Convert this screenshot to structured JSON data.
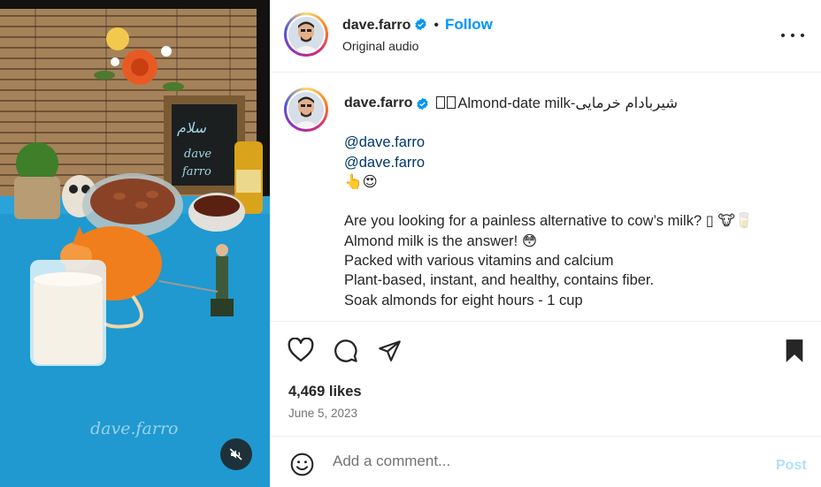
{
  "post": {
    "watermark": "dave.farro",
    "header": {
      "username": "dave.farro",
      "verified": true,
      "follow_label": "Follow",
      "subtitle": "Original audio"
    },
    "caption": {
      "username": "dave.farro",
      "title": "Almond-date milk-شیربادام خرمایی",
      "mentions": [
        "@dave.farro",
        "@dave.farro"
      ],
      "emoji_line": "👆😍",
      "lines": [
        "Are you looking for a painless alternative to cow’s milk? ▯ 🐮🥛",
        "Almond milk is the answer! 😳",
        "Packed with various vitamins and calcium",
        "Plant-based, instant, and healthy, contains fiber.",
        "Soak almonds for eight hours - 1 cup"
      ]
    },
    "likes": "4,469 likes",
    "date": "June 5, 2023",
    "comment": {
      "placeholder": "Add a comment...",
      "post_label": "Post"
    }
  },
  "icons": {
    "header_more": "more-options-icon",
    "like": "heart-icon",
    "comment": "comment-icon",
    "share": "share-icon",
    "save": "bookmark-icon",
    "emoji": "emoji-icon",
    "mute": "mute-icon",
    "verified": "verified-badge-icon"
  },
  "colors": {
    "accent": "#0095f6",
    "mention": "#00376b",
    "post_disabled": "#b2dffc",
    "muted_text": "#737373"
  }
}
